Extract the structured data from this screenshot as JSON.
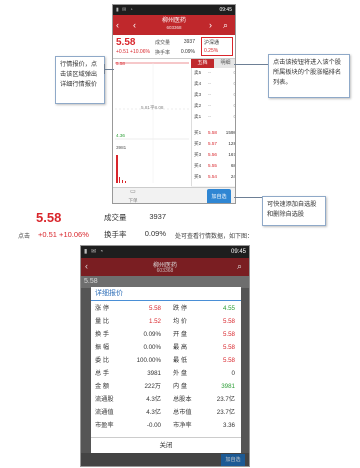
{
  "phone1": {
    "status": {
      "left": "",
      "time": "09:45"
    },
    "title": {
      "name": "柳州医药",
      "code": "603368",
      "back": "‹",
      "prev": "‹",
      "next": "›",
      "search": "⌕"
    },
    "quote": {
      "price": "5.58",
      "change": "+0.51 +10.06%",
      "volume_label": "成交量",
      "volume_value": "3937",
      "turnover_label": "换手率",
      "turnover_value": "0.09%",
      "index_name": "沪深通",
      "index_change": "0.25%"
    },
    "chart": {
      "price_high": "5.58",
      "price_low": "4.36",
      "volume_label": "3981",
      "mid_label": "5.81平8.08"
    },
    "tabs": [
      "五档",
      "明细"
    ],
    "orderbook": [
      {
        "label": "卖5",
        "price": "--",
        "vol": "0"
      },
      {
        "label": "卖4",
        "price": "--",
        "vol": "0"
      },
      {
        "label": "卖3",
        "price": "--",
        "vol": "0"
      },
      {
        "label": "卖2",
        "price": "--",
        "vol": "0"
      },
      {
        "label": "卖1",
        "price": "--",
        "vol": "0"
      },
      {
        "label": "买1",
        "price": "5.58",
        "vol": "1598"
      },
      {
        "label": "买2",
        "price": "5.57",
        "vol": "128"
      },
      {
        "label": "买3",
        "price": "5.56",
        "vol": "167"
      },
      {
        "label": "买4",
        "price": "5.55",
        "vol": "68"
      },
      {
        "label": "买5",
        "price": "5.54",
        "vol": "24"
      }
    ],
    "footer": {
      "left_label": "下单",
      "add_label": "加自选"
    }
  },
  "callouts": {
    "left": "行情报价，点击该区域弹出详细行情报价",
    "right": "点击该按钮将进入该个股所属板块的个股涨幅排名列表。",
    "bottom": "可快速添加自选股和删除自选股"
  },
  "strip": {
    "before": "点击",
    "price": "5.58",
    "change": "+0.51 +10.06%",
    "vol_label": "成交量",
    "vol_value": "3937",
    "turn_label": "换手率",
    "turn_value": "0.09%",
    "after": "处可查看行情数据，如下图："
  },
  "phone2": {
    "status": {
      "time": "09:45"
    },
    "title": {
      "name": "柳州医药",
      "code": "603368"
    },
    "under": "5.58",
    "dialog_title": "详细报价",
    "rows": [
      {
        "l1": "涨 停",
        "v1": "5.58",
        "c1": "red",
        "l2": "跌 停",
        "v2": "4.55",
        "c2": "green"
      },
      {
        "l1": "量 比",
        "v1": "1.52",
        "c1": "red",
        "l2": "均 价",
        "v2": "5.58",
        "c2": "red"
      },
      {
        "l1": "换 手",
        "v1": "0.09%",
        "c1": "",
        "l2": "开 盘",
        "v2": "5.58",
        "c2": "red"
      },
      {
        "l1": "振 幅",
        "v1": "0.00%",
        "c1": "",
        "l2": "最 高",
        "v2": "5.58",
        "c2": "red"
      },
      {
        "l1": "委 比",
        "v1": "100.00%",
        "c1": "",
        "l2": "最 低",
        "v2": "5.58",
        "c2": "red"
      },
      {
        "l1": "总 手",
        "v1": "3981",
        "c1": "",
        "l2": "外 盘",
        "v2": "0",
        "c2": ""
      },
      {
        "l1": "金 额",
        "v1": "222万",
        "c1": "",
        "l2": "内 盘",
        "v2": "3981",
        "c2": "green"
      },
      {
        "l1": "流通股",
        "v1": "4.3亿",
        "c1": "",
        "l2": "总股本",
        "v2": "23.7亿",
        "c2": ""
      },
      {
        "l1": "流通值",
        "v1": "4.3亿",
        "c1": "",
        "l2": "总市值",
        "v2": "23.7亿",
        "c2": ""
      },
      {
        "l1": "市盈率",
        "v1": "-0.00",
        "c1": "",
        "l2": "市净率",
        "v2": "3.36",
        "c2": ""
      }
    ],
    "close_label": "关闭",
    "add_label": "加自选"
  },
  "colors": {
    "brand_red": "#c0282c",
    "price_red": "#d9262c",
    "down_green": "#2a9d34",
    "add_blue": "#2f86d3"
  }
}
